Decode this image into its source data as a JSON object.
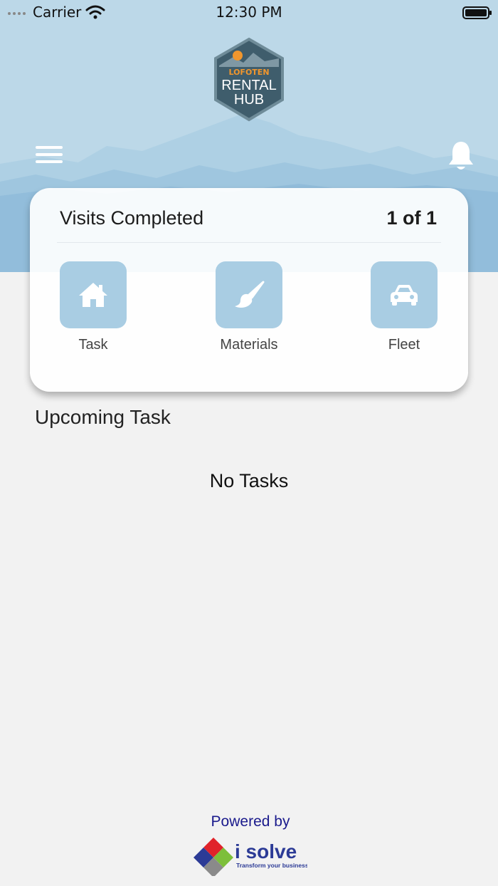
{
  "status_bar": {
    "carrier": "Carrier",
    "time": "12:30 PM"
  },
  "logo": {
    "line1": "LOFOTEN",
    "line2": "RENTAL",
    "line3": "HUB"
  },
  "card": {
    "title": "Visits Completed",
    "count": "1 of 1",
    "actions": [
      {
        "label": "Task",
        "icon": "house-icon"
      },
      {
        "label": "Materials",
        "icon": "paintbrush-icon"
      },
      {
        "label": "Fleet",
        "icon": "car-icon"
      }
    ]
  },
  "upcoming": {
    "heading": "Upcoming Task",
    "empty_text": "No Tasks"
  },
  "footer": {
    "powered_by": "Powered by",
    "brand": "i solve",
    "tagline": "Transform your business."
  },
  "colors": {
    "header_bg": "#bcd8e8",
    "tile_bg": "#a9cde3",
    "logo_accent": "#f0962d",
    "footer_blue": "#1a1a8c"
  }
}
